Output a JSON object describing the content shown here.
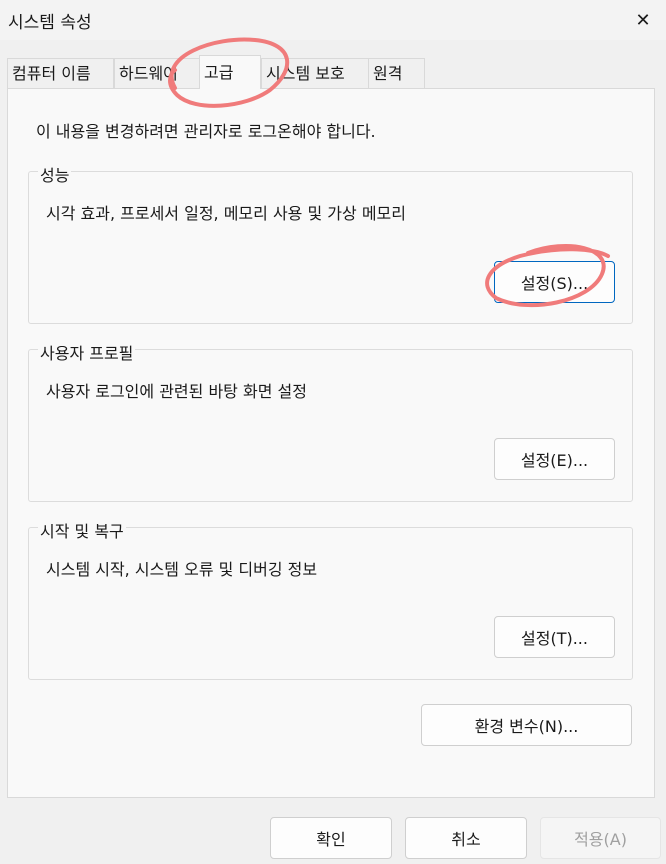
{
  "window": {
    "title": "시스템 속성",
    "close_icon": "✕"
  },
  "tabs": [
    {
      "label": "컴퓨터 이름",
      "active": false
    },
    {
      "label": "하드웨어",
      "active": false
    },
    {
      "label": "고급",
      "active": true
    },
    {
      "label": "시스템 보호",
      "active": false
    },
    {
      "label": "원격",
      "active": false
    }
  ],
  "advanced": {
    "admin_notice": "이 내용을 변경하려면 관리자로 로그온해야 합니다.",
    "performance": {
      "title": "성능",
      "description": "시각 효과, 프로세서 일정, 메모리 사용 및 가상 메모리",
      "button": "설정(S)..."
    },
    "user_profiles": {
      "title": "사용자 프로필",
      "description": "사용자 로그인에 관련된 바탕 화면 설정",
      "button": "설정(E)..."
    },
    "startup_recovery": {
      "title": "시작 및 복구",
      "description": "시스템 시작, 시스템 오류 및 디버깅 정보",
      "button": "설정(T)..."
    },
    "env_vars_button": "환경 변수(N)..."
  },
  "footer": {
    "ok": "확인",
    "cancel": "취소",
    "apply": "적용(A)"
  },
  "colors": {
    "annotation": "#f07b7b",
    "accent": "#0067c0"
  }
}
